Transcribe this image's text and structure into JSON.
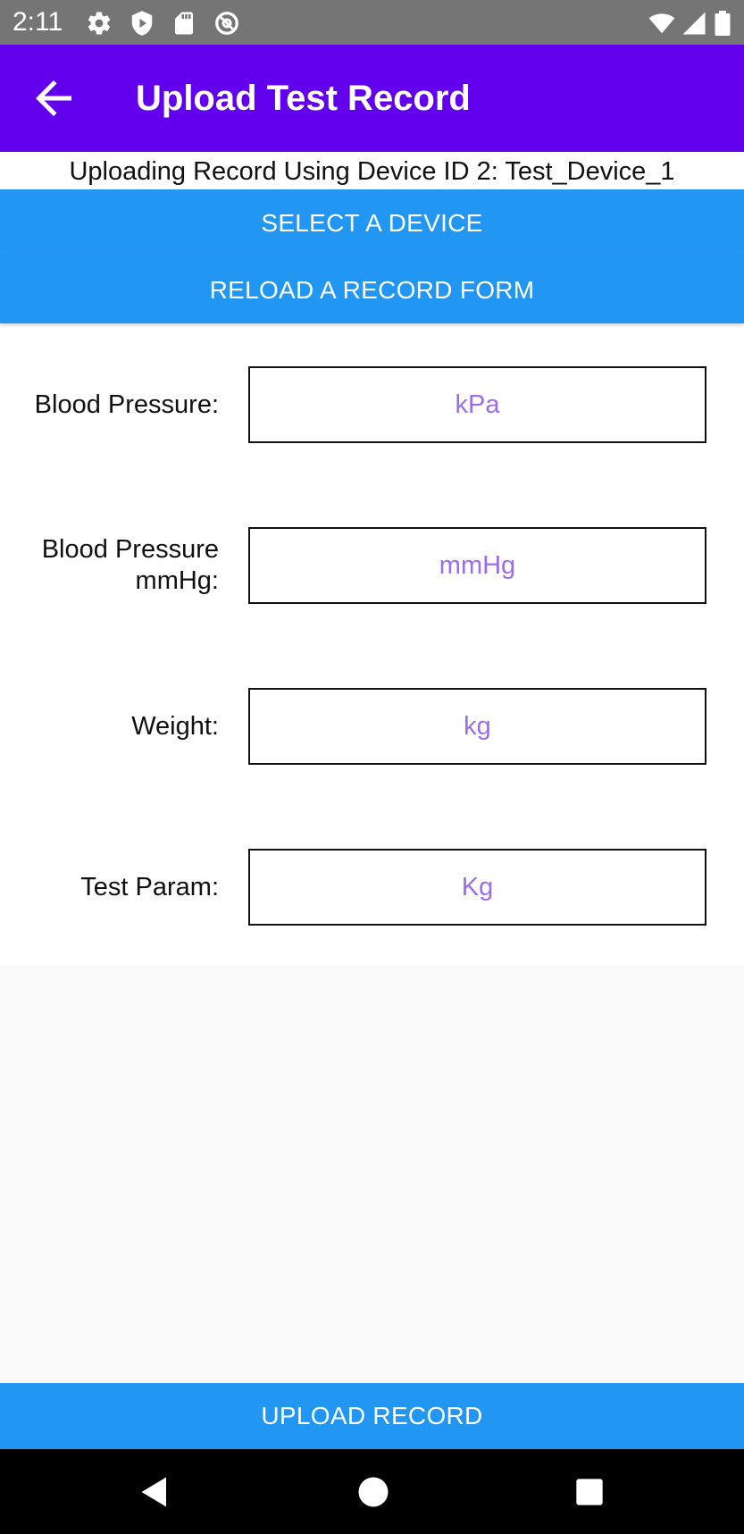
{
  "status_bar": {
    "time": "2:11",
    "left_icons": [
      "settings-icon",
      "shield-play-icon",
      "sd-card-icon",
      "at-sign-icon"
    ],
    "right_icons": [
      "wifi-icon",
      "signal-icon",
      "battery-icon"
    ]
  },
  "app_bar": {
    "title": "Upload Test Record",
    "background_color": "#6200ee"
  },
  "device_info": "Uploading Record Using Device ID 2: Test_Device_1",
  "buttons": {
    "select_device": "SELECT A DEVICE",
    "reload_form": "RELOAD A RECORD FORM",
    "upload_record": "UPLOAD RECORD",
    "color": "#2196f3"
  },
  "form": {
    "fields": [
      {
        "label_line1": "Blood Pressure:",
        "label_line2": "",
        "value": "",
        "placeholder": "kPa"
      },
      {
        "label_line1": "Blood Pressure",
        "label_line2": "mmHg:",
        "value": "",
        "placeholder": "mmHg"
      },
      {
        "label_line1": "Weight:",
        "label_line2": "",
        "value": "",
        "placeholder": "kg"
      },
      {
        "label_line1": "Test Param:",
        "label_line2": "",
        "value": "",
        "placeholder": "Kg"
      }
    ]
  },
  "nav_bar": {
    "icons": [
      "back-triangle-icon",
      "home-circle-icon",
      "recents-square-icon"
    ]
  }
}
